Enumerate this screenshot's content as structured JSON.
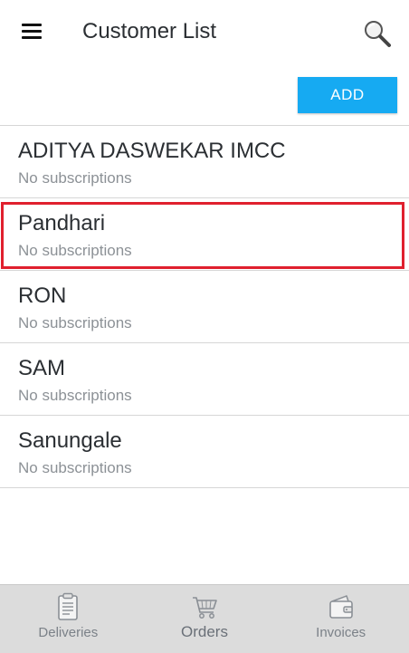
{
  "header": {
    "title": "Customer List",
    "menu_icon": "hamburger-menu-icon",
    "search_icon": "search-icon"
  },
  "toolbar": {
    "add_label": "ADD"
  },
  "customers": [
    {
      "name": "ADITYA DASWEKAR IMCC",
      "subscriptions": "No subscriptions"
    },
    {
      "name": "Pandhari",
      "subscriptions": "No subscriptions"
    },
    {
      "name": "RON",
      "subscriptions": "No subscriptions"
    },
    {
      "name": "SAM",
      "subscriptions": "No subscriptions"
    },
    {
      "name": "Sanungale",
      "subscriptions": "No subscriptions"
    }
  ],
  "bottom_nav": [
    {
      "label": "Deliveries",
      "icon": "clipboard-icon"
    },
    {
      "label": "Orders",
      "icon": "cart-icon"
    },
    {
      "label": "Invoices",
      "icon": "wallet-icon"
    }
  ],
  "colors": {
    "accent": "#16aaf2",
    "highlight": "#e0202e",
    "nav_background": "#dcdcdc",
    "divider": "#d6d6d6"
  }
}
